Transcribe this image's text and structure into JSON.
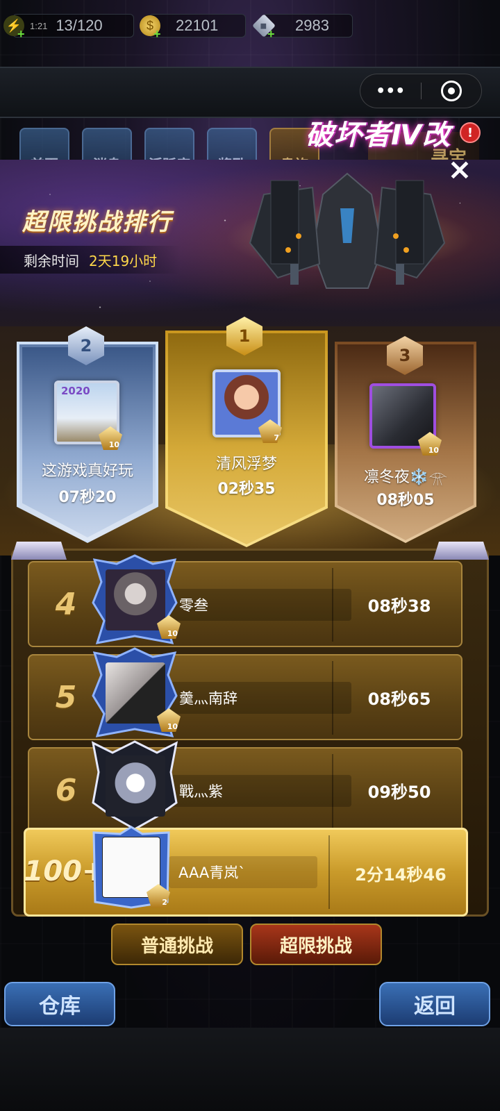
{
  "resources": {
    "energy_timer": "1:21",
    "energy": "13/120",
    "gold": "22101",
    "gems": "2983"
  },
  "capsule": {
    "more_label": "•••"
  },
  "menu": {
    "items": [
      "首页",
      "消息",
      "活跃度",
      "奖励",
      "贵族"
    ],
    "treasure_label": "寻宝",
    "alert": "!"
  },
  "banner": {
    "title": "超限挑战排行",
    "remaining_label": "剩余时间",
    "remaining_value": "2天19小时",
    "ship_name": "破坏者Ⅳ改"
  },
  "close_label": "×",
  "podium": [
    {
      "place": "2",
      "year_tag": "2020",
      "name": "这游戏真好玩",
      "time": "07秒20",
      "level": "10"
    },
    {
      "place": "1",
      "name": "清风浮梦",
      "time": "02秒35",
      "level": "7"
    },
    {
      "place": "3",
      "name": "凛冬夜❄️𓁿",
      "time": "08秒05",
      "level": "10"
    }
  ],
  "rows": [
    {
      "rank": "4",
      "name": "零叁",
      "time": "08秒38",
      "level": "10"
    },
    {
      "rank": "5",
      "name": "羹灬南辞",
      "time": "08秒65",
      "level": "10"
    },
    {
      "rank": "6",
      "name": "戰灬紫",
      "time": "09秒50",
      "level": ""
    }
  ],
  "me": {
    "rank": "100+",
    "name": "AAA青岚`",
    "time": "2分14秒46",
    "level": "2"
  },
  "bottom": {
    "normal": "普通挑战",
    "extreme": "超限挑战",
    "warehouse": "仓库",
    "back": "返回"
  }
}
